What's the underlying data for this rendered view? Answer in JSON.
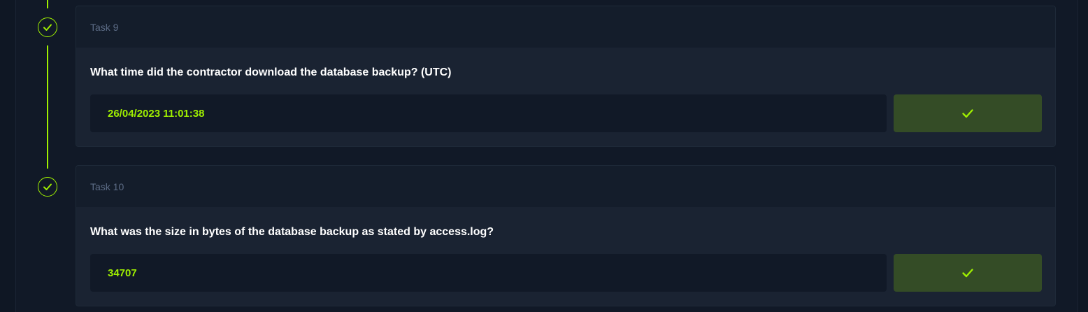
{
  "tasks": [
    {
      "title": "Task 9",
      "question": "What time did the contractor download the database backup? (UTC)",
      "answer": "26/04/2023 11:01:38",
      "status": "completed"
    },
    {
      "title": "Task 10",
      "question": "What was the size in bytes of the database backup as stated by access.log?",
      "answer": "34707",
      "status": "completed"
    }
  ],
  "colors": {
    "accent": "#9fef00",
    "background": "#111927",
    "card": "#1a2332",
    "card_header": "#141d2b",
    "submit_button": "#344c26",
    "muted_text": "#5d6c86"
  },
  "icons": {
    "node": "check-icon",
    "submit": "check-icon"
  }
}
